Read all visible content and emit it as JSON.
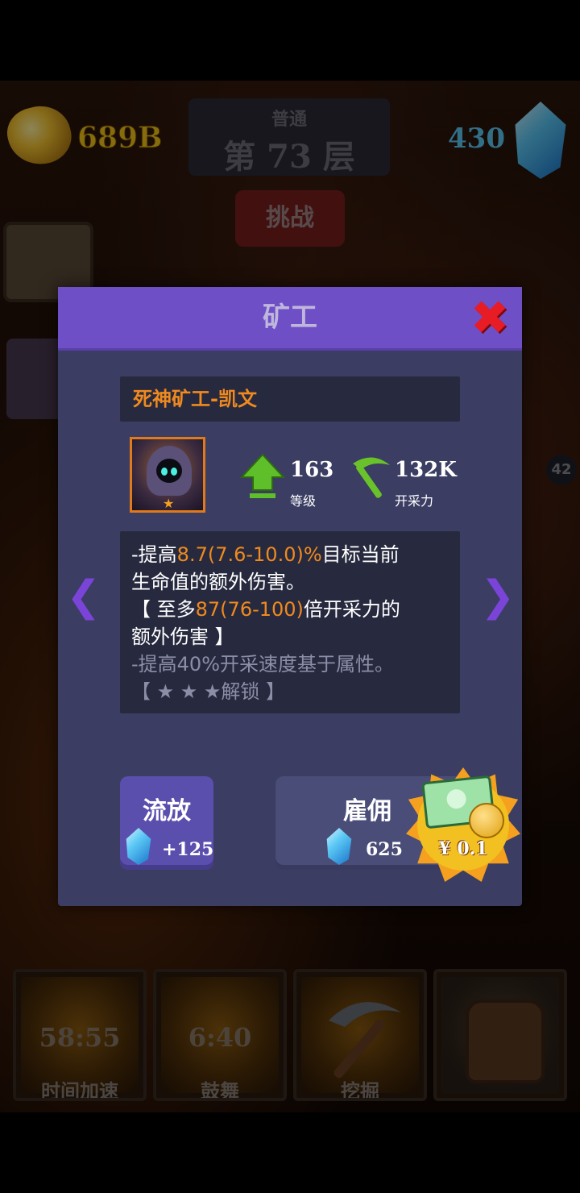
{
  "hud": {
    "gold": "689B",
    "floor_mode": "普通",
    "floor_label": "第 73 层",
    "gems": "430",
    "challenge_label": "挑战",
    "side_count": "42"
  },
  "modal": {
    "title": "矿工",
    "miner_name": "死神矿工-凯文",
    "level_value": "163",
    "level_label": "等级",
    "mining_power_value": "132K",
    "mining_power_label": "开采力",
    "description": {
      "line1_prefix": "-提高",
      "line1_highlight": "8.7(7.6-10.0)%",
      "line1_suffix": "目标当前",
      "line2": "生命值的额外伤害。",
      "line3_prefix": "【 至多",
      "line3_highlight": "87(76-100)",
      "line3_suffix": "倍开采力的",
      "line4": "额外伤害 】",
      "line5": "-提高40%开采速度基于属性。",
      "line6": "【 ★ ★ ★解锁 】"
    },
    "exile_button": {
      "label": "流放",
      "value": "+125"
    },
    "hire_button": {
      "label": "雇佣",
      "value": "625"
    },
    "price_badge": "¥ 0.1"
  },
  "actions": [
    {
      "timer": "58:55",
      "label": "时间加速"
    },
    {
      "timer": "6:40",
      "label": "鼓舞"
    },
    {
      "timer": "",
      "label": "挖掘"
    },
    {
      "timer": "",
      "label": ""
    }
  ],
  "colors": {
    "modal_header": "#6e4fc6",
    "modal_body": "#3b3d63",
    "highlight": "#f08a1e",
    "close": "#e81c24"
  }
}
